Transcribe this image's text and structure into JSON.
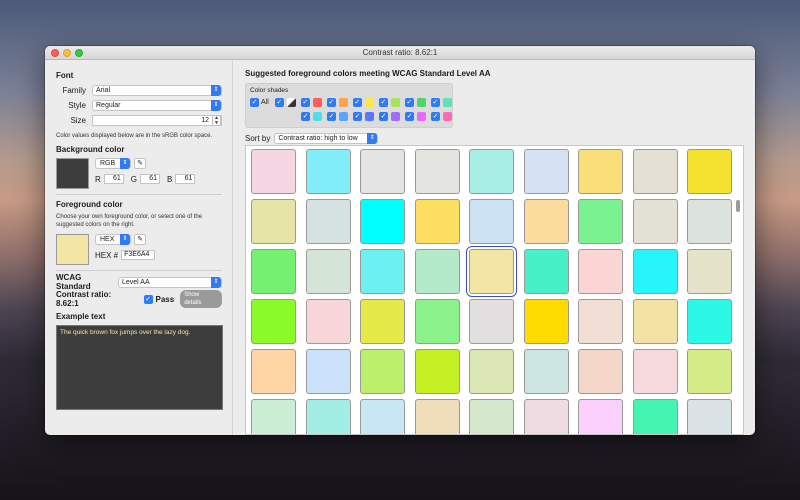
{
  "window": {
    "title": "Contrast ratio: 8.62:1"
  },
  "font": {
    "heading": "Font",
    "family_label": "Family",
    "family_value": "Arial",
    "style_label": "Style",
    "style_value": "Regular",
    "size_label": "Size",
    "size_value": "12"
  },
  "note_srgb": "Color values displayed below are in the sRGB color space.",
  "background": {
    "heading": "Background color",
    "mode": "RGB",
    "r_label": "R",
    "r": "61",
    "g_label": "G",
    "g": "61",
    "b_label": "B",
    "b": "61",
    "swatch": "#3D3D3D"
  },
  "foreground": {
    "heading": "Foreground color",
    "note": "Choose your own foreground color, or select one of the suggested colors on the right.",
    "mode": "HEX",
    "hex_label": "HEX #",
    "hex": "F3E6A4",
    "swatch": "#F3E6A4"
  },
  "wcag": {
    "label": "WCAG Standard",
    "value": "Level AA",
    "ratio_text": "Contrast ratio: 8.62:1",
    "pass_label": "Pass",
    "details_label": "Show details"
  },
  "example": {
    "heading": "Example text",
    "text": "The quick brown fox jumps over the lazy dog."
  },
  "suggest": {
    "heading": "Suggested foreground colors meeting WCAG Standard Level AA",
    "shades_label": "Color shades",
    "all_label": "All",
    "row1_colors": [
      "#8e8e8e",
      "#ff5c5c",
      "#ffa24d",
      "#ffe64a",
      "#a8e35a",
      "#4fd66a",
      "#5fe3b4"
    ],
    "row2_colors": [
      "#4fdfe8",
      "#5aa6ff",
      "#5a78ff",
      "#a26bff",
      "#e56bff",
      "#ff6bb0"
    ],
    "sort_label": "Sort by",
    "sort_value": "Contrast ratio: high to low",
    "colors": [
      "#F6D6E2",
      "#82EEFA",
      "#E4E4E4",
      "#E4E4E0",
      "#A8EEE6",
      "#D6E2F4",
      "#FADE78",
      "#E4E0D6",
      "#F4E22E",
      "#E6E4A6",
      "#D6E2E2",
      "#00FFFF",
      "#FCDE60",
      "#CCE2F2",
      "#FCDC9C",
      "#7AF290",
      "#E4E2D6",
      "#DCE2DC",
      "#76F070",
      "#D4E4D6",
      "#6CF0F0",
      "#B4EACA",
      "#F3E6A4",
      "#48F0C8",
      "#FCD6D4",
      "#28F4FC",
      "#E6E4C8",
      "#8AFA28",
      "#F8D6DA",
      "#E6EA48",
      "#8AF288",
      "#E2E0E0",
      "#FFDC00",
      "#F2DED4",
      "#F2E2A4",
      "#2CF8E6",
      "#FED6A6",
      "#CCE2FC",
      "#BCF06C",
      "#C4F024",
      "#DAE6B4",
      "#CCE4E2",
      "#F4D6C8",
      "#F6DADE",
      "#D6EC86",
      "#CCEED4",
      "#A2EEE4",
      "#C8E6F4",
      "#F0DEBA",
      "#D6E8CC",
      "#EEDCE2",
      "#FCD0FC",
      "#46F4B2",
      "#DAE4E6"
    ],
    "selected_index": 22
  }
}
